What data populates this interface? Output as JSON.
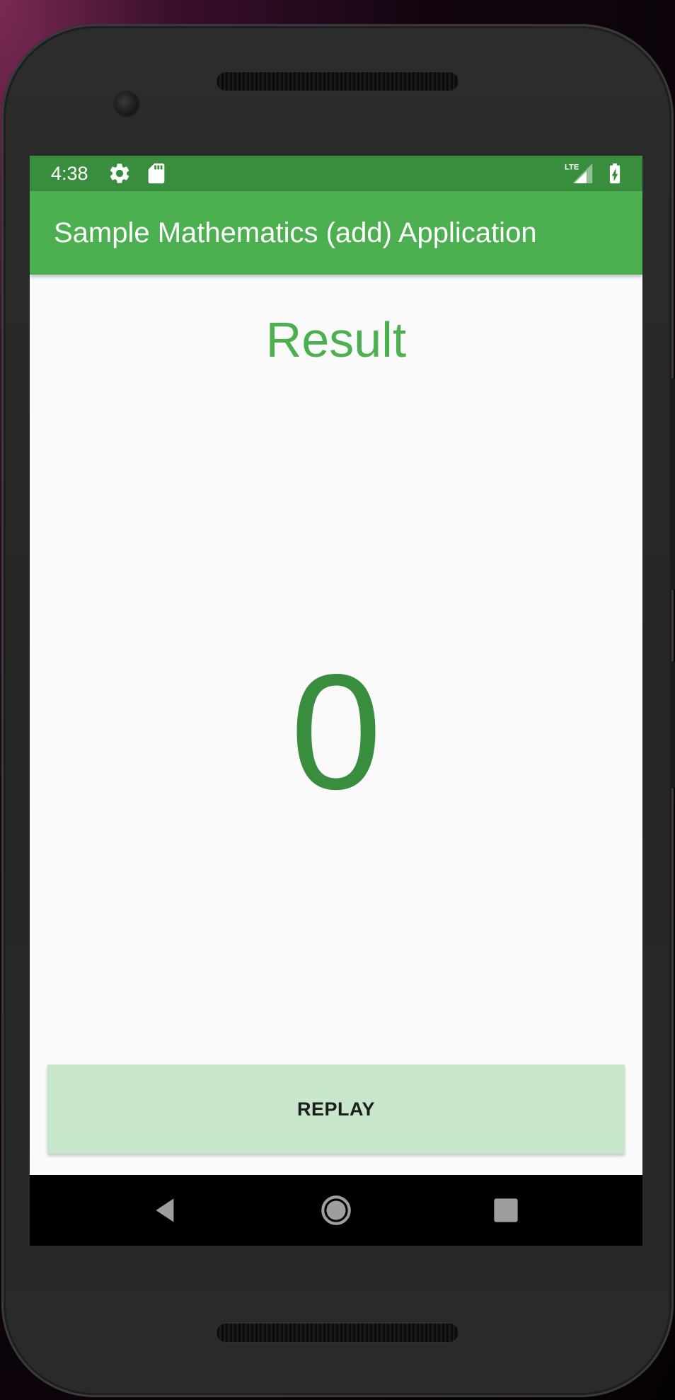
{
  "status_bar": {
    "time": "4:38",
    "icons": [
      "settings-gear-icon",
      "sd-card-icon",
      "lte-signal-icon",
      "battery-charging-icon"
    ],
    "network_label": "LTE"
  },
  "app_bar": {
    "title": "Sample Mathematics (add) Application"
  },
  "main": {
    "result_label": "Result",
    "result_value": "0",
    "replay_button_label": "REPLAY"
  },
  "nav_bar": {
    "icons": [
      "back-icon",
      "home-icon",
      "recents-icon"
    ]
  },
  "colors": {
    "status_bar": "#388e3c",
    "app_bar": "#4caf50",
    "result_label": "#4caf50",
    "result_value": "#388e3c",
    "button_background": "#c8e6c9",
    "screen_background": "#fafafa"
  }
}
